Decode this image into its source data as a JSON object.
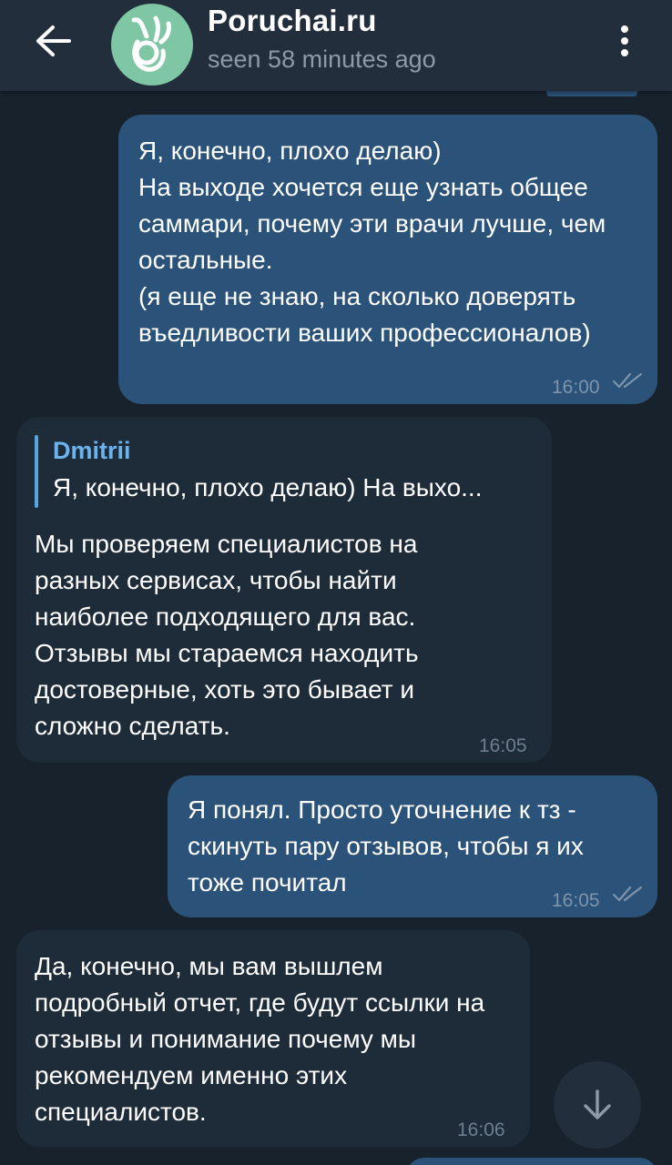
{
  "header": {
    "title": "Poruchai.ru",
    "status": "seen 58 minutes ago",
    "avatar_icon": "ok-hand-icon",
    "avatar_color": "#7fc6a4"
  },
  "messages": [
    {
      "direction": "outgoing",
      "text": "Я, конечно, плохо делаю)\nНа выходе хочется еще узнать общее саммари, почему эти врачи лучше, чем остальные.\n(я еще не знаю, на сколько доверять въедливости ваших профессионалов)",
      "time": "16:00",
      "read": true
    },
    {
      "direction": "incoming",
      "reply_author": "Dmitrii",
      "reply_text": "Я, конечно, плохо делаю) На выхо...",
      "text": "Мы проверяем специалистов на разных сервисах, чтобы найти наиболее подходящего для вас. Отзывы мы стараемся находить достоверные, хоть это бывает и сложно сделать.",
      "time": "16:05"
    },
    {
      "direction": "outgoing",
      "text": "Я понял. Просто уточнение к тз - скинуть пару отзывов, чтобы я их тоже почитал",
      "time": "16:05",
      "read": true
    },
    {
      "direction": "incoming",
      "text": "Да, конечно, мы вам вышлем подробный отчет, где будут ссылки на отзывы и понимание почему мы рекомендуем именно этих специалистов.",
      "time": "16:06"
    }
  ],
  "colors": {
    "background": "#18222d",
    "header": "#232e3c",
    "outgoing_bubble": "#2b5278",
    "incoming_bubble": "#1e2c3a",
    "reply_accent": "#5aa4e0"
  }
}
